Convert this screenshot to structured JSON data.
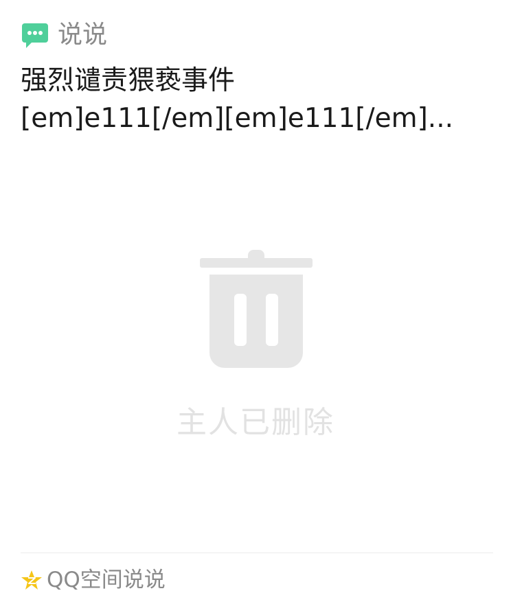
{
  "header": {
    "icon": "chat-bubble-icon",
    "accent_color": "#4fcf9a",
    "type_label": "说说"
  },
  "post": {
    "text": "强烈谴责猥亵事件\n[em]e111[/em][em]e111[/em]..."
  },
  "deleted_state": {
    "icon": "trash-can-icon",
    "icon_color": "#e6e6e6",
    "label": "主人已删除"
  },
  "footer": {
    "icon": "star-icon",
    "star_color": "#f5c518",
    "source_label": "QQ空间说说"
  }
}
